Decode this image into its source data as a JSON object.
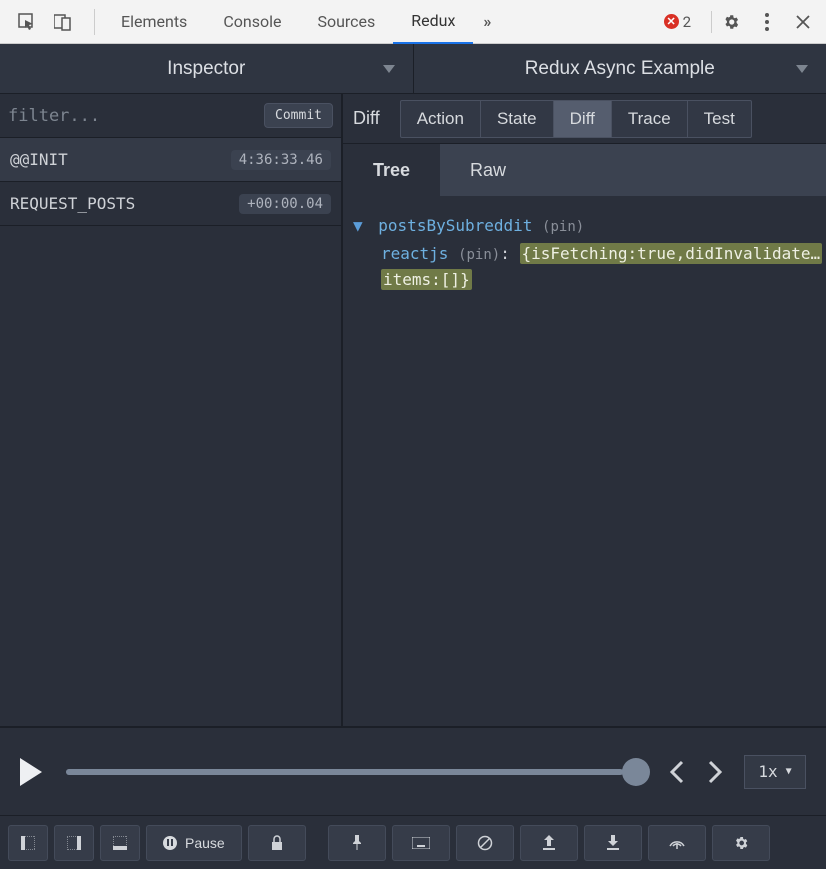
{
  "devtools": {
    "tabs": [
      "Elements",
      "Console",
      "Sources",
      "Redux"
    ],
    "active_tab": "Redux",
    "overflow_glyph": "»",
    "error_count": "2"
  },
  "redux_header": {
    "left_label": "Inspector",
    "right_label": "Redux Async Example"
  },
  "filter": {
    "placeholder": "filter...",
    "commit_label": "Commit"
  },
  "actions": [
    {
      "name": "@@INIT",
      "timestamp": "4:36:33.46",
      "selected": true
    },
    {
      "name": "REQUEST_POSTS",
      "timestamp": "+00:00.04",
      "selected": false
    }
  ],
  "view_tabs": {
    "label": "Diff",
    "items": [
      "Action",
      "State",
      "Diff",
      "Trace",
      "Test"
    ],
    "active": "Diff"
  },
  "subtabs": {
    "items": [
      "Tree",
      "Raw"
    ],
    "active": "Tree"
  },
  "tree": {
    "root_key": "postsBySubreddit",
    "pin_label": "(pin)",
    "child_key": "reactjs",
    "child_value_line1": "{isFetching:true,didInvalidate…",
    "child_value_line2": "items:[]}"
  },
  "playback": {
    "speed": "1x"
  },
  "bottom": {
    "pause_label": "Pause"
  }
}
